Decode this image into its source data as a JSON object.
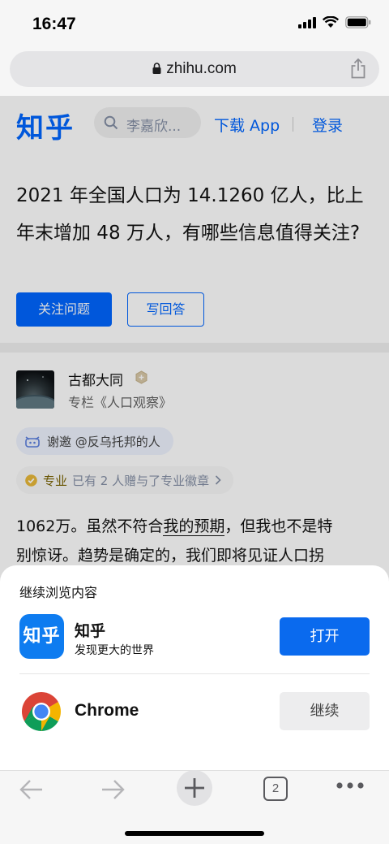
{
  "status_bar": {
    "time": "16:47"
  },
  "browser": {
    "url": "zhihu.com",
    "tab_count": "2"
  },
  "zhihu_header": {
    "logo": "知乎",
    "search_placeholder": "李嘉欣...",
    "download_app": "下载 App",
    "login": "登录"
  },
  "question": {
    "title": "2021 年全国人口为 14.1260 亿人，比上年末增加 48 万人，有哪些信息值得关注?",
    "follow_button": "关注问题",
    "answer_button": "写回答"
  },
  "answer": {
    "author_name": "古都大同",
    "author_column": "专栏《人口观察》",
    "invite_text": "谢邀 @反乌托邦的人",
    "pro_label": "专业",
    "pro_text": "已有 2 人赠与了专业徽章",
    "body_line1_a": "1062万。虽然不符合",
    "body_line1_b": "我的预期",
    "body_line1_c": "，但我也不是特",
    "body_line2": "别惊讶。趋势是确定的，我们即将见证人口拐"
  },
  "sheet": {
    "title": "继续浏览内容",
    "zhihu_app": {
      "icon_text": "知乎",
      "name": "知乎",
      "subtitle": "发现更大的世界",
      "button": "打开"
    },
    "chrome_app": {
      "name": "Chrome",
      "button": "继续"
    }
  },
  "colors": {
    "zhihu_blue": "#0066ff",
    "open_button": "#0a6aee"
  }
}
